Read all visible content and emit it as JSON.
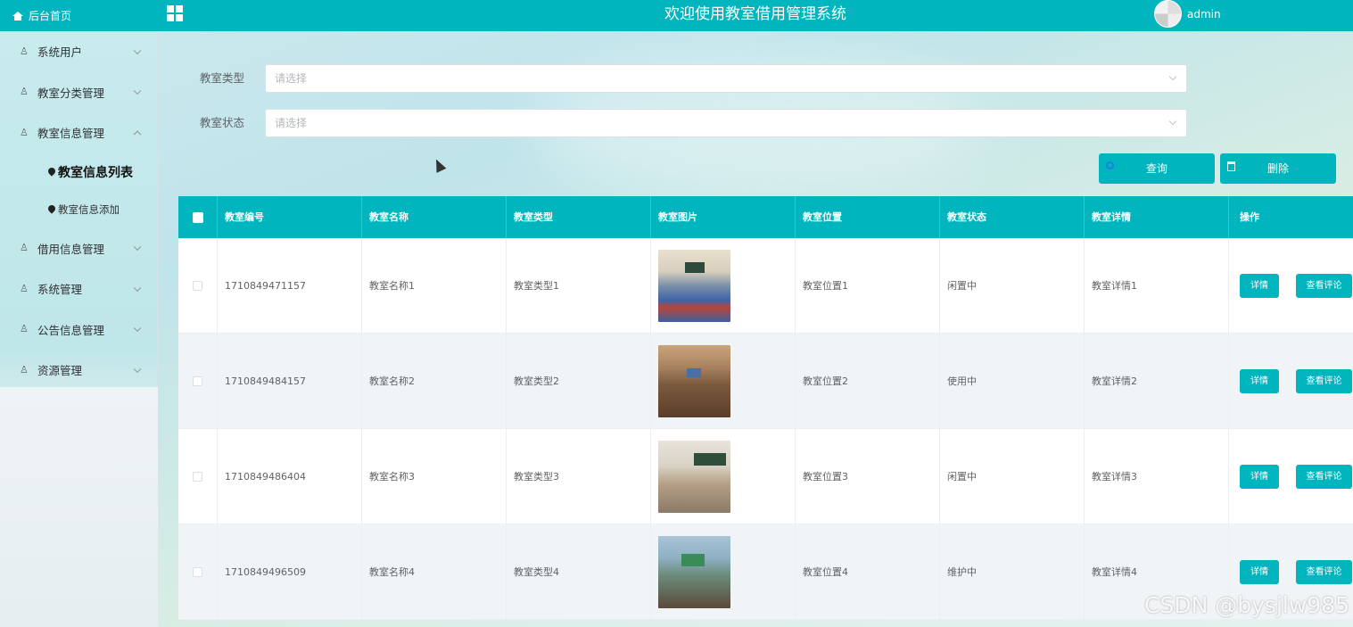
{
  "header": {
    "title": "欢迎使用教室借用管理系统",
    "username": "admin"
  },
  "sidebar": {
    "home_label": "后台首页",
    "items": [
      {
        "label": "系统用户",
        "expanded": false
      },
      {
        "label": "教室分类管理",
        "expanded": false
      },
      {
        "label": "教室信息管理",
        "expanded": true
      },
      {
        "label": "借用信息管理",
        "expanded": false
      },
      {
        "label": "系统管理",
        "expanded": false
      },
      {
        "label": "公告信息管理",
        "expanded": false
      },
      {
        "label": "资源管理",
        "expanded": false
      }
    ],
    "sub_items": [
      {
        "label": "教室信息列表",
        "active": true
      },
      {
        "label": "教室信息添加",
        "active": false
      }
    ]
  },
  "filters": {
    "type_label": "教室类型",
    "type_placeholder": "请选择",
    "status_label": "教室状态",
    "status_placeholder": "请选择",
    "search_button": "查询",
    "delete_button": "删除"
  },
  "table": {
    "headers": [
      "教室编号",
      "教室名称",
      "教室类型",
      "教室图片",
      "教室位置",
      "教室状态",
      "教室详情",
      "操作"
    ],
    "rows": [
      {
        "id": "1710849471157",
        "name": "教室名称1",
        "type": "教室类型1",
        "location": "教室位置1",
        "status": "闲置中",
        "detail": "教室详情1"
      },
      {
        "id": "1710849484157",
        "name": "教室名称2",
        "type": "教室类型2",
        "location": "教室位置2",
        "status": "使用中",
        "detail": "教室详情2"
      },
      {
        "id": "1710849486404",
        "name": "教室名称3",
        "type": "教室类型3",
        "location": "教室位置3",
        "status": "闲置中",
        "detail": "教室详情3"
      },
      {
        "id": "1710849496509",
        "name": "教室名称4",
        "type": "教室类型4",
        "location": "教室位置4",
        "status": "维护中",
        "detail": "教室详情4"
      }
    ],
    "detail_button": "详情",
    "review_button": "查看评论"
  },
  "watermark": "CSDN @bysjlw985",
  "colors": {
    "primary": "#00b5bd"
  }
}
